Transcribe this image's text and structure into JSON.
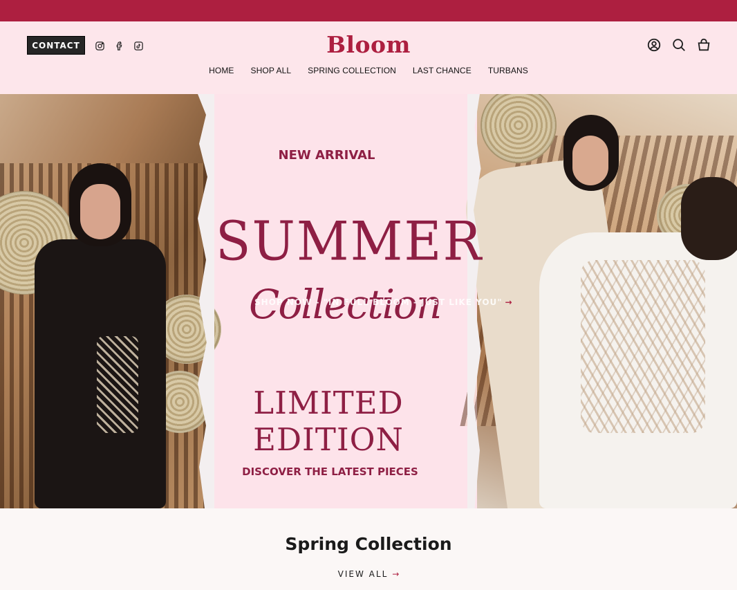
{
  "announcement_bar": {
    "color": "#ad1f40"
  },
  "header": {
    "contact_label": "CONTACT",
    "logo_text": "Bloom",
    "social_icons": [
      "instagram-icon",
      "facebook-icon",
      "tiktok-icon"
    ],
    "action_icons": [
      "account-icon",
      "search-icon",
      "cart-icon"
    ],
    "nav": [
      "HOME",
      "SHOP ALL",
      "SPRING COLLECTION",
      "LAST CHANCE",
      "TURBANS"
    ],
    "background": "#fde6eb"
  },
  "hero": {
    "eyebrow": "NEW ARRIVAL",
    "headline": "SUMMER",
    "script_text": "Collection",
    "subheadline": "LIMITED EDITION",
    "tagline": "DISCOVER THE LATEST PIECES",
    "cta_label": "SHOP NOW - \"IN FULL BLOOM - JUST LIKE YOU\"",
    "cta_arrow": "→",
    "accent": "#8e1f44"
  },
  "section": {
    "title": "Spring Collection",
    "view_all_label": "VIEW ALL",
    "view_all_arrow": "→"
  }
}
